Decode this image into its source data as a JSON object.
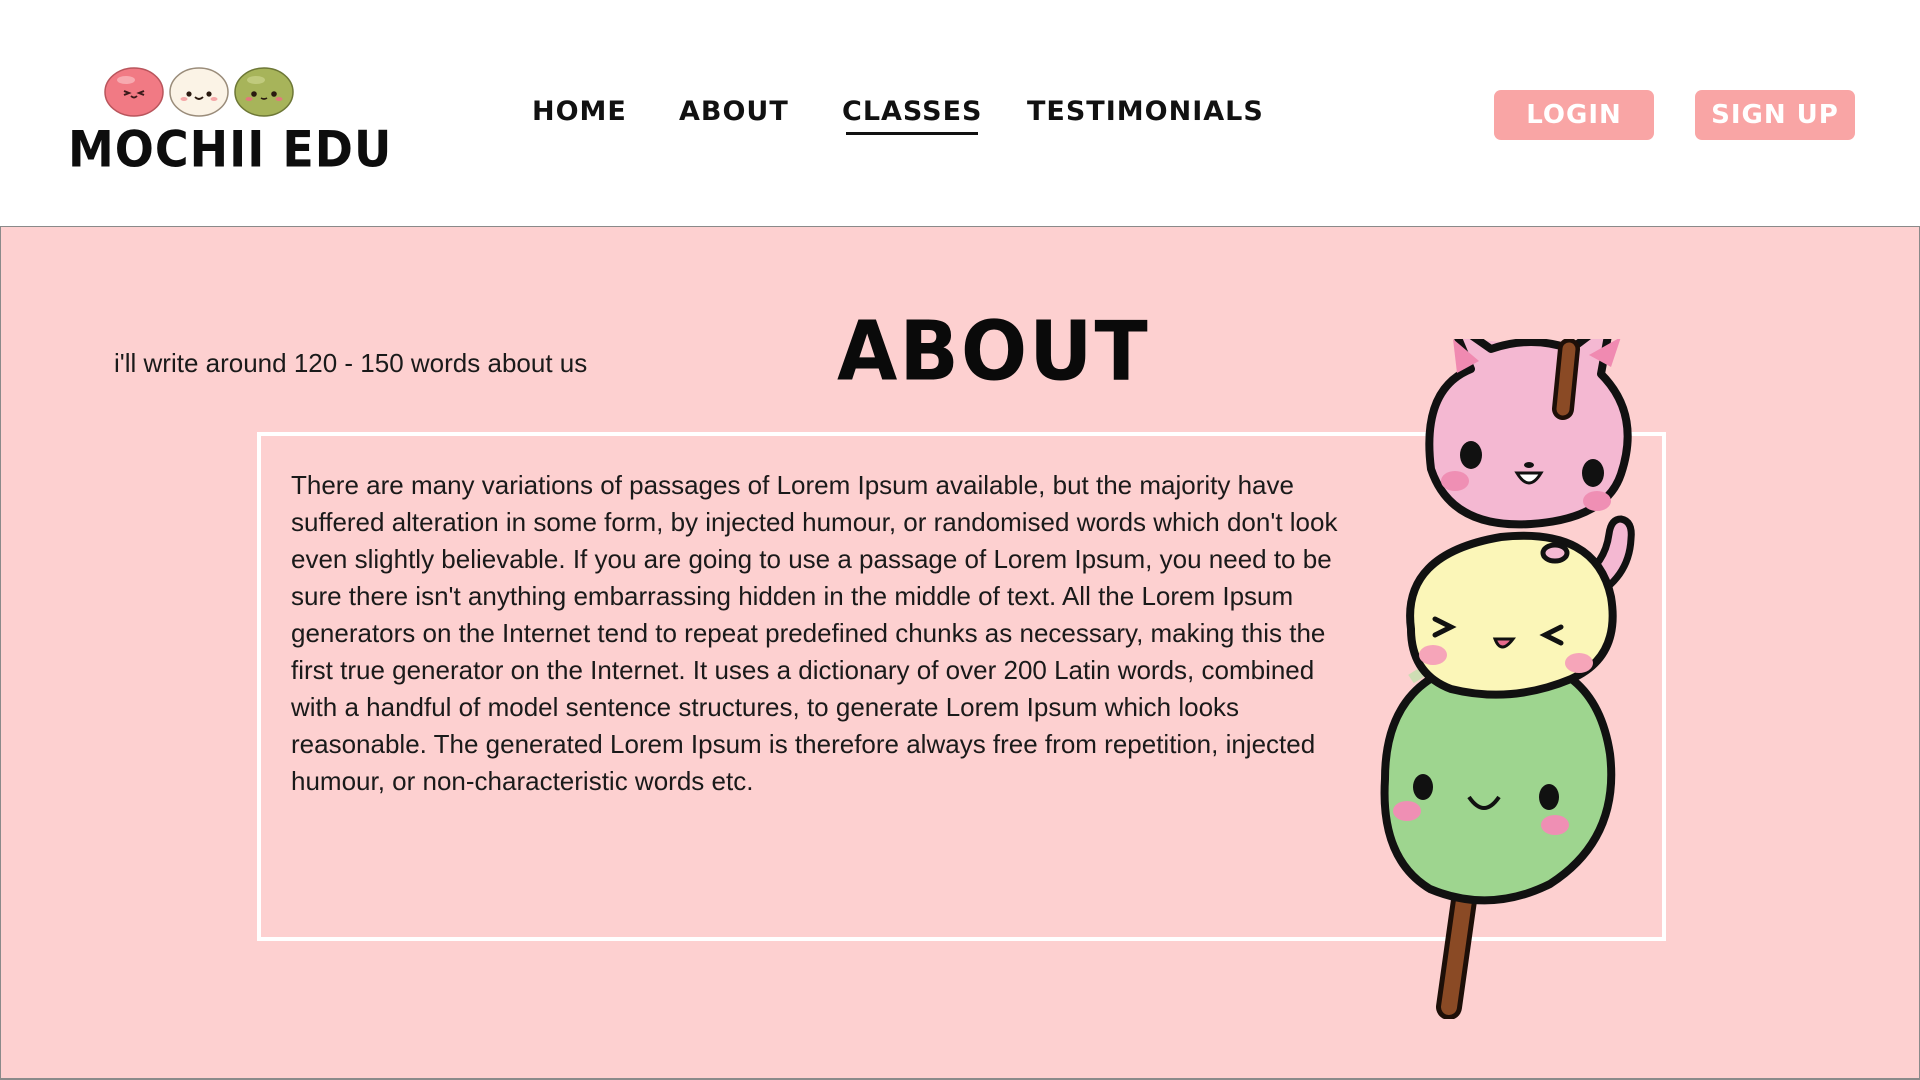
{
  "header": {
    "brand": "MOCHII EDU",
    "logo_icon": "mochi-trio-icon",
    "nav": [
      {
        "label": "HOME",
        "active": false
      },
      {
        "label": "ABOUT",
        "active": false
      },
      {
        "label": "CLASSES",
        "active": true
      },
      {
        "label": "TESTIMONIALS",
        "active": false
      }
    ],
    "login_label": "LOGIN",
    "signup_label": "SIGN UP"
  },
  "main": {
    "note": "i'll write around 120 - 150 words about us",
    "title": "ABOUT",
    "body": "There are many variations of passages of Lorem Ipsum available, but the majority have suffered alteration in some form, by injected humour, or randomised words which don't look even slightly believable. If you are going to use a passage of Lorem Ipsum, you need to be sure there isn't anything embarrassing hidden in the middle of text. All the Lorem Ipsum generators on the Internet tend to repeat predefined chunks as necessary, making this the first true generator on the Internet. It uses a dictionary of over 200 Latin words, combined with a handful of model sentence structures, to generate Lorem Ipsum which looks reasonable. The generated Lorem Ipsum is therefore always free from repetition, injected humour, or non-characteristic words etc.",
    "illustration": "cat-dango-illustration"
  },
  "colors": {
    "accent_pink": "#f9a5a5",
    "background_pink": "#fdd0d0",
    "mochi_pink": "#f4b8d2",
    "mochi_yellow": "#fbf6b8",
    "mochi_green": "#9ed58f"
  }
}
